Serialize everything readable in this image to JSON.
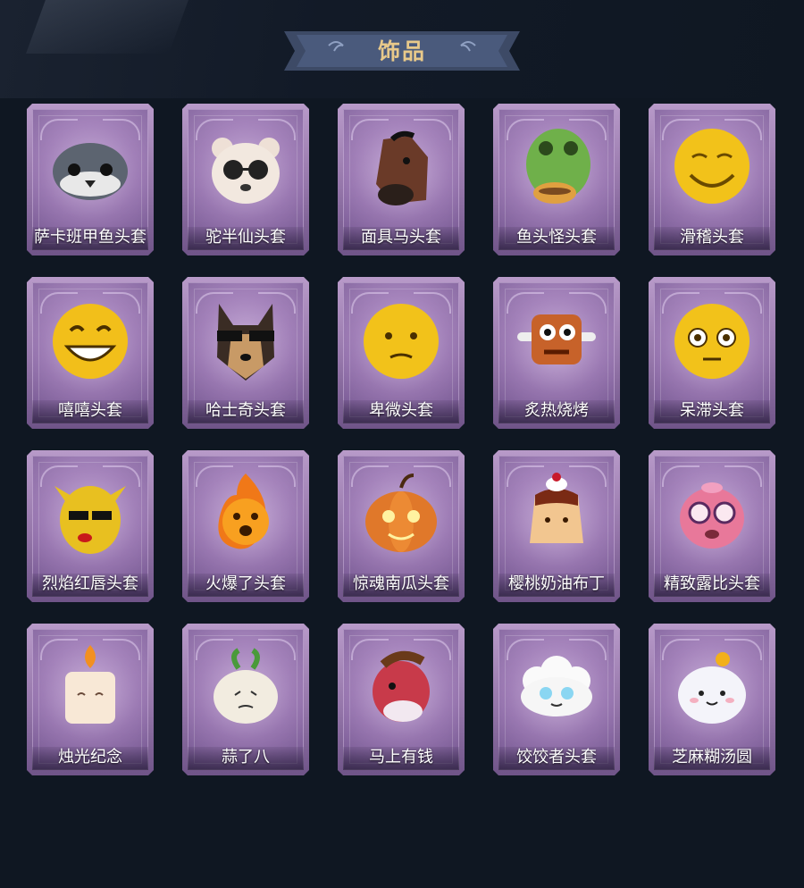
{
  "header": {
    "title": "饰品"
  },
  "items": [
    {
      "label": "萨卡班甲鱼头套",
      "icon": "fish-head-icon"
    },
    {
      "label": "驼半仙头套",
      "icon": "bear-sunglasses-icon"
    },
    {
      "label": "面具马头套",
      "icon": "horse-mask-icon"
    },
    {
      "label": "鱼头怪头套",
      "icon": "green-fish-mask-icon"
    },
    {
      "label": "滑稽头套",
      "icon": "funny-face-icon"
    },
    {
      "label": "嘻嘻头套",
      "icon": "grin-face-icon"
    },
    {
      "label": "哈士奇头套",
      "icon": "husky-sunglasses-icon"
    },
    {
      "label": "卑微头套",
      "icon": "humble-face-icon"
    },
    {
      "label": "炙热烧烤",
      "icon": "bbq-meat-icon"
    },
    {
      "label": "呆滞头套",
      "icon": "dazed-face-icon"
    },
    {
      "label": "烈焰红唇头套",
      "icon": "yellow-mouse-icon"
    },
    {
      "label": "火爆了头套",
      "icon": "fire-spirit-icon"
    },
    {
      "label": "惊魂南瓜头套",
      "icon": "pumpkin-icon"
    },
    {
      "label": "樱桃奶油布丁",
      "icon": "pudding-icon"
    },
    {
      "label": "精致露比头套",
      "icon": "pink-beaver-icon"
    },
    {
      "label": "烛光纪念",
      "icon": "candle-icon"
    },
    {
      "label": "蒜了八",
      "icon": "garlic-icon"
    },
    {
      "label": "马上有钱",
      "icon": "red-horse-icon"
    },
    {
      "label": "饺饺者头套",
      "icon": "dumpling-icon"
    },
    {
      "label": "芝麻糊汤圆",
      "icon": "rice-ball-icon"
    }
  ]
}
